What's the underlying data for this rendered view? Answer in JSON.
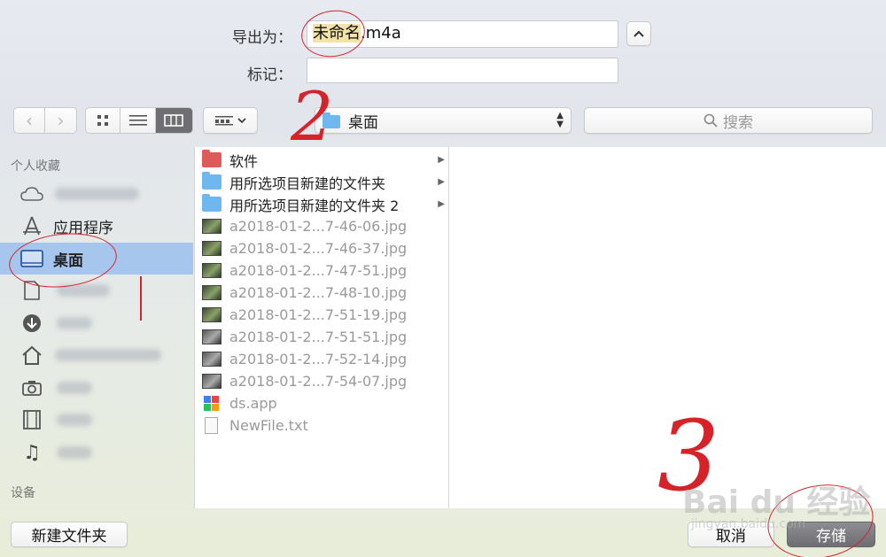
{
  "form": {
    "export_label": "导出为：",
    "filename_selected": "未命名",
    "filename_ext": ".m4a",
    "tags_label": "标记：",
    "tags_value": ""
  },
  "toolbar": {
    "location": "桌面",
    "search_placeholder": "搜索",
    "view_mode": "column"
  },
  "sidebar": {
    "favorites_heading": "个人收藏",
    "devices_heading": "设备",
    "items": [
      {
        "label": "",
        "icon": "cloud-icon",
        "blurred": true
      },
      {
        "label": "应用程序",
        "icon": "applications-icon"
      },
      {
        "label": "桌面",
        "icon": "desktop-icon",
        "active": true
      },
      {
        "label": "",
        "icon": "document-icon",
        "blurred": true
      },
      {
        "label": "",
        "icon": "downloads-icon",
        "blurred": true
      },
      {
        "label": "",
        "icon": "home-icon",
        "blurred": true
      },
      {
        "label": "",
        "icon": "camera-icon",
        "blurred": true
      },
      {
        "label": "",
        "icon": "movies-icon",
        "blurred": true
      },
      {
        "label": "",
        "icon": "music-icon",
        "blurred": true
      }
    ]
  },
  "files": [
    {
      "name": "软件",
      "kind": "folder-red",
      "folder": true
    },
    {
      "name": "用所选项目新建的文件夹",
      "kind": "folder-blue",
      "folder": true
    },
    {
      "name": "用所选项目新建的文件夹 2",
      "kind": "folder-blue",
      "folder": true
    },
    {
      "name": "a2018-01-2...7-46-06.jpg",
      "kind": "image",
      "disabled": true
    },
    {
      "name": "a2018-01-2...7-46-37.jpg",
      "kind": "image",
      "disabled": true
    },
    {
      "name": "a2018-01-2...7-47-51.jpg",
      "kind": "image",
      "disabled": true
    },
    {
      "name": "a2018-01-2...7-48-10.jpg",
      "kind": "image",
      "disabled": true
    },
    {
      "name": "a2018-01-2...7-51-19.jpg",
      "kind": "image",
      "disabled": true
    },
    {
      "name": "a2018-01-2...7-51-51.jpg",
      "kind": "image-alt",
      "disabled": true
    },
    {
      "name": "a2018-01-2...7-52-14.jpg",
      "kind": "image-alt",
      "disabled": true
    },
    {
      "name": "a2018-01-2...7-54-07.jpg",
      "kind": "image-alt",
      "disabled": true
    },
    {
      "name": "ds.app",
      "kind": "app",
      "disabled": true
    },
    {
      "name": "NewFile.txt",
      "kind": "text",
      "disabled": true
    }
  ],
  "footer": {
    "new_folder": "新建文件夹",
    "cancel": "取消",
    "save": "存储"
  },
  "annotations": {
    "step2": "2",
    "step3": "3",
    "watermark_main": "Bai du 经验",
    "watermark_sub": "jingyan.baidu.com"
  },
  "colors": {
    "accent_selection": "#a7c6ee",
    "annotation_red": "#d6232a"
  }
}
